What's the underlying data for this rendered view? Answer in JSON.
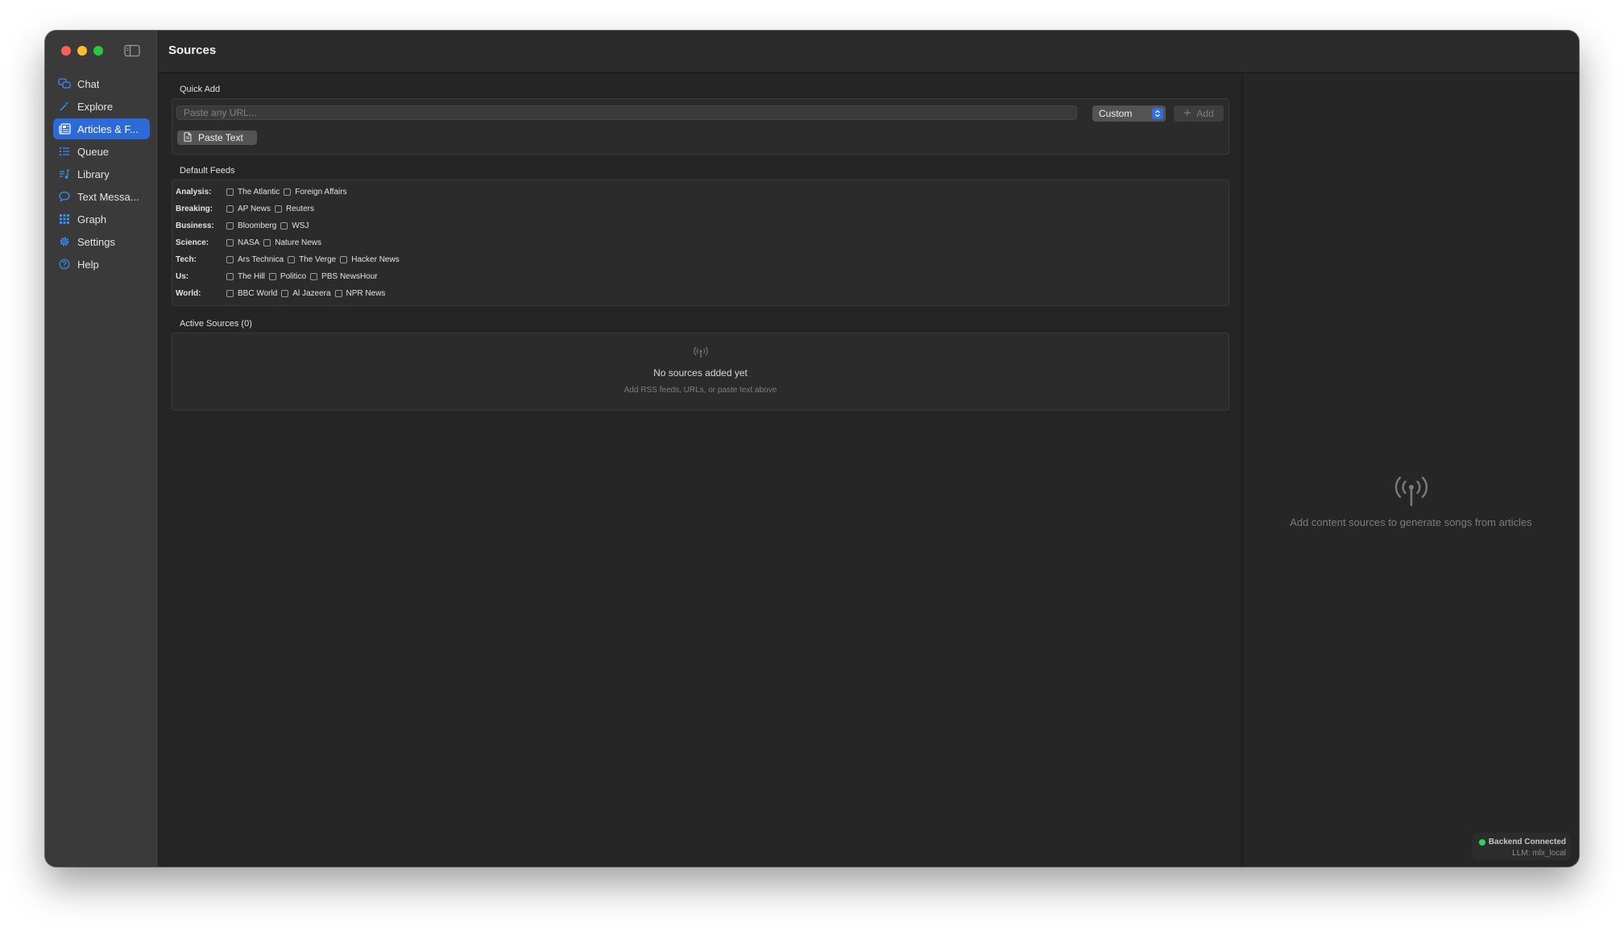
{
  "window": {
    "title": "Sources"
  },
  "sidebar": {
    "items": [
      {
        "label": "Chat",
        "icon": "chat-bubbles-icon",
        "active": false
      },
      {
        "label": "Explore",
        "icon": "wand-icon",
        "active": false
      },
      {
        "label": "Articles & F...",
        "icon": "newspaper-icon",
        "active": true
      },
      {
        "label": "Queue",
        "icon": "list-icon",
        "active": false
      },
      {
        "label": "Library",
        "icon": "music-list-icon",
        "active": false
      },
      {
        "label": "Text Messa...",
        "icon": "message-bubble-icon",
        "active": false
      },
      {
        "label": "Graph",
        "icon": "grid-icon",
        "active": false
      },
      {
        "label": "Settings",
        "icon": "gear-icon",
        "active": false
      },
      {
        "label": "Help",
        "icon": "help-icon",
        "active": false
      }
    ]
  },
  "quick_add": {
    "label": "Quick Add",
    "url_placeholder": "Paste any URL...",
    "type_select": "Custom",
    "add_label": "Add",
    "paste_label": "Paste Text"
  },
  "default_feeds": {
    "label": "Default Feeds",
    "categories": [
      {
        "name": "Analysis:",
        "feeds": [
          "The Atlantic",
          "Foreign Affairs"
        ]
      },
      {
        "name": "Breaking:",
        "feeds": [
          "AP News",
          "Reuters"
        ]
      },
      {
        "name": "Business:",
        "feeds": [
          "Bloomberg",
          "WSJ"
        ]
      },
      {
        "name": "Science:",
        "feeds": [
          "NASA",
          "Nature News"
        ]
      },
      {
        "name": "Tech:",
        "feeds": [
          "Ars Technica",
          "The Verge",
          "Hacker News"
        ]
      },
      {
        "name": "Us:",
        "feeds": [
          "The Hill",
          "Politico",
          "PBS NewsHour"
        ]
      },
      {
        "name": "World:",
        "feeds": [
          "BBC World",
          "Al Jazeera",
          "NPR News"
        ]
      }
    ]
  },
  "active_sources": {
    "label": "Active Sources (0)",
    "empty_title": "No sources added yet",
    "empty_subtitle": "Add RSS feeds, URLs, or paste text above"
  },
  "detail": {
    "message": "Add content sources to generate songs from articles"
  },
  "status": {
    "backend": "Backend Connected",
    "llm": "LLM: mlx_local",
    "color": "#30d158"
  },
  "colors": {
    "accent": "#2c6ad9",
    "icon_blue": "#3a8ef6"
  }
}
